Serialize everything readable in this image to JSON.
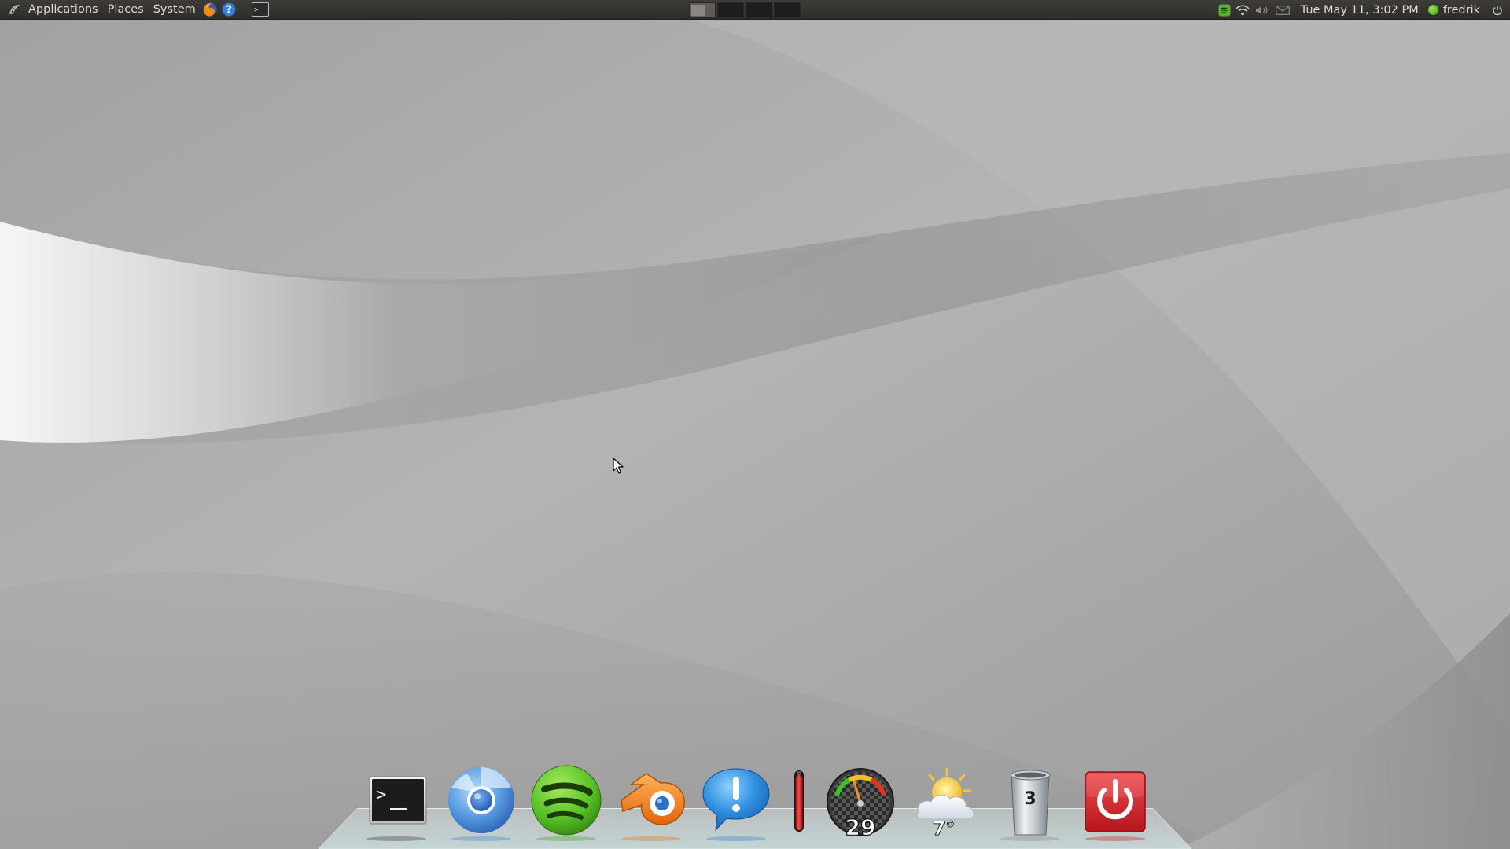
{
  "top_panel": {
    "menus": {
      "applications": "Applications",
      "places": "Places",
      "system": "System"
    },
    "launchers": [
      "firefox-icon",
      "help-icon",
      "terminal-icon"
    ],
    "workspaces": {
      "count": 4,
      "active": 1
    },
    "tray_icons": [
      "spotify-icon",
      "wifi-icon",
      "volume-icon",
      "mail-icon"
    ],
    "clock": "Tue May 11,  3:02 PM",
    "user": "fredrik",
    "session_icon": "power-icon"
  },
  "dock": {
    "items": [
      {
        "name": "terminal",
        "icon": "terminal-icon"
      },
      {
        "name": "chromium",
        "icon": "chromium-icon"
      },
      {
        "name": "spotify",
        "icon": "spotify-icon"
      },
      {
        "name": "blender",
        "icon": "blender-icon"
      },
      {
        "name": "notifications",
        "icon": "exclamation-icon"
      },
      {
        "name": "meter",
        "icon": "thermometer-icon"
      },
      {
        "name": "gauge",
        "icon": "gauge-icon",
        "value": "29"
      },
      {
        "name": "weather",
        "icon": "weather-icon",
        "temperature": "7°"
      },
      {
        "name": "trash",
        "icon": "trash-icon",
        "count": "3"
      },
      {
        "name": "shutdown",
        "icon": "power-icon"
      }
    ]
  },
  "colors": {
    "panel": "#3a3935",
    "panel_text": "#dfdbd2",
    "wallpaper": "#a9a9a9",
    "spotify": "#56c026",
    "power": "#d0262c",
    "notify": "#2f8fe0"
  }
}
